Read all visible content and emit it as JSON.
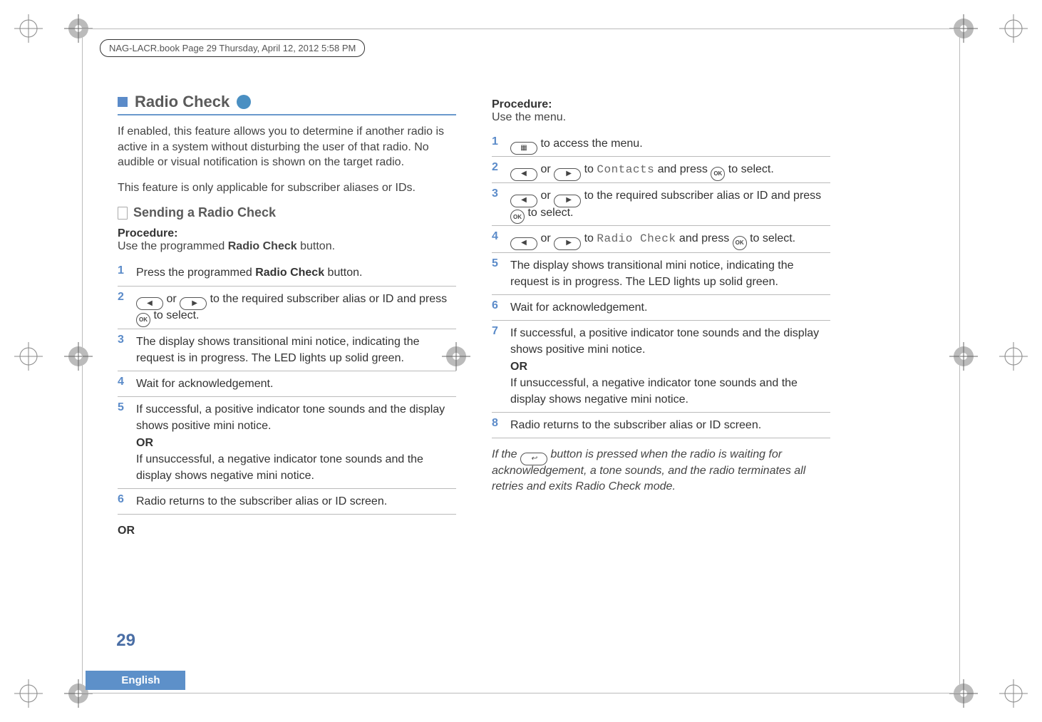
{
  "file_header": "NAG-LACR.book  Page 29  Thursday, April 12, 2012  5:58 PM",
  "page_number": "29",
  "language": "English",
  "left": {
    "section_title": "Radio Check",
    "intro1": "If enabled, this feature allows you to determine if another radio is active in a system without disturbing the user of that radio. No audible or visual notification is shown on the target radio.",
    "intro2": "This feature is only applicable for subscriber aliases or IDs.",
    "sub_heading": "Sending a Radio Check",
    "procedure_label": "Procedure:",
    "procedure_intro_pre": "Use the programmed ",
    "procedure_intro_bold": "Radio Check",
    "procedure_intro_post": " button.",
    "steps": {
      "s1_pre": "Press the programmed ",
      "s1_bold": "Radio Check",
      "s1_post": " button.",
      "s2_mid": " to the required subscriber alias or ID and press ",
      "s2_end": " to select.",
      "s3": "The display shows transitional mini notice, indicating the request is in progress. The LED lights up solid green.",
      "s4": "Wait for acknowledgement.",
      "s5a": "If successful, a positive indicator tone sounds and the display shows positive mini notice.",
      "s5or": "OR",
      "s5b": "If unsuccessful, a negative indicator tone sounds and the display shows negative mini notice.",
      "s6": "Radio returns to the subscriber alias or ID screen."
    },
    "bottom_or": "OR"
  },
  "right": {
    "procedure_label": "Procedure:",
    "procedure_intro": "Use the menu.",
    "steps": {
      "s1_post": " to access the menu.",
      "s2_or": " or ",
      "s2_to": " to ",
      "s2_contacts": "Contacts",
      "s2_press": " and press ",
      "s2_end": " to select.",
      "s3_mid": " to the required subscriber alias or ID and press ",
      "s3_end": " to select.",
      "s4_to": " to ",
      "s4_rc": "Radio Check",
      "s4_press": " and press ",
      "s4_end": " to select.",
      "s5": "The display shows transitional mini notice, indicating the request is in progress. The LED lights up solid green.",
      "s6": "Wait for acknowledgement.",
      "s7a": "If successful, a positive indicator tone sounds and the display shows positive mini notice.",
      "s7or": "OR",
      "s7b": "If unsuccessful, a negative indicator tone sounds and the display shows negative mini notice.",
      "s8": "Radio returns to the subscriber alias or ID screen."
    },
    "footnote_pre": "If the ",
    "footnote_post": " button is pressed when the radio is waiting for acknowledgement, a tone sounds, and the radio terminates all retries and exits Radio Check mode."
  },
  "words": {
    "or": " or "
  }
}
